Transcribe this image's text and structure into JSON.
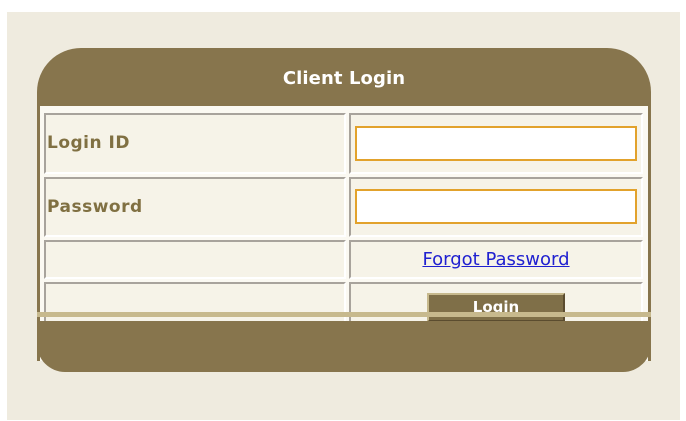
{
  "header": {
    "title": "Client Login"
  },
  "form": {
    "fields": [
      {
        "label": "Login ID",
        "value": "",
        "placeholder": ""
      },
      {
        "label": "Password",
        "value": "",
        "placeholder": ""
      }
    ],
    "forgot_password_label": "Forgot Password",
    "login_button_label": "Login"
  },
  "colors": {
    "panel_background": "#efebdf",
    "header_background": "#87754d",
    "label_text": "#807042",
    "input_border": "#e2a22c",
    "link": "#2020d0",
    "button_background": "#7f6f48"
  }
}
